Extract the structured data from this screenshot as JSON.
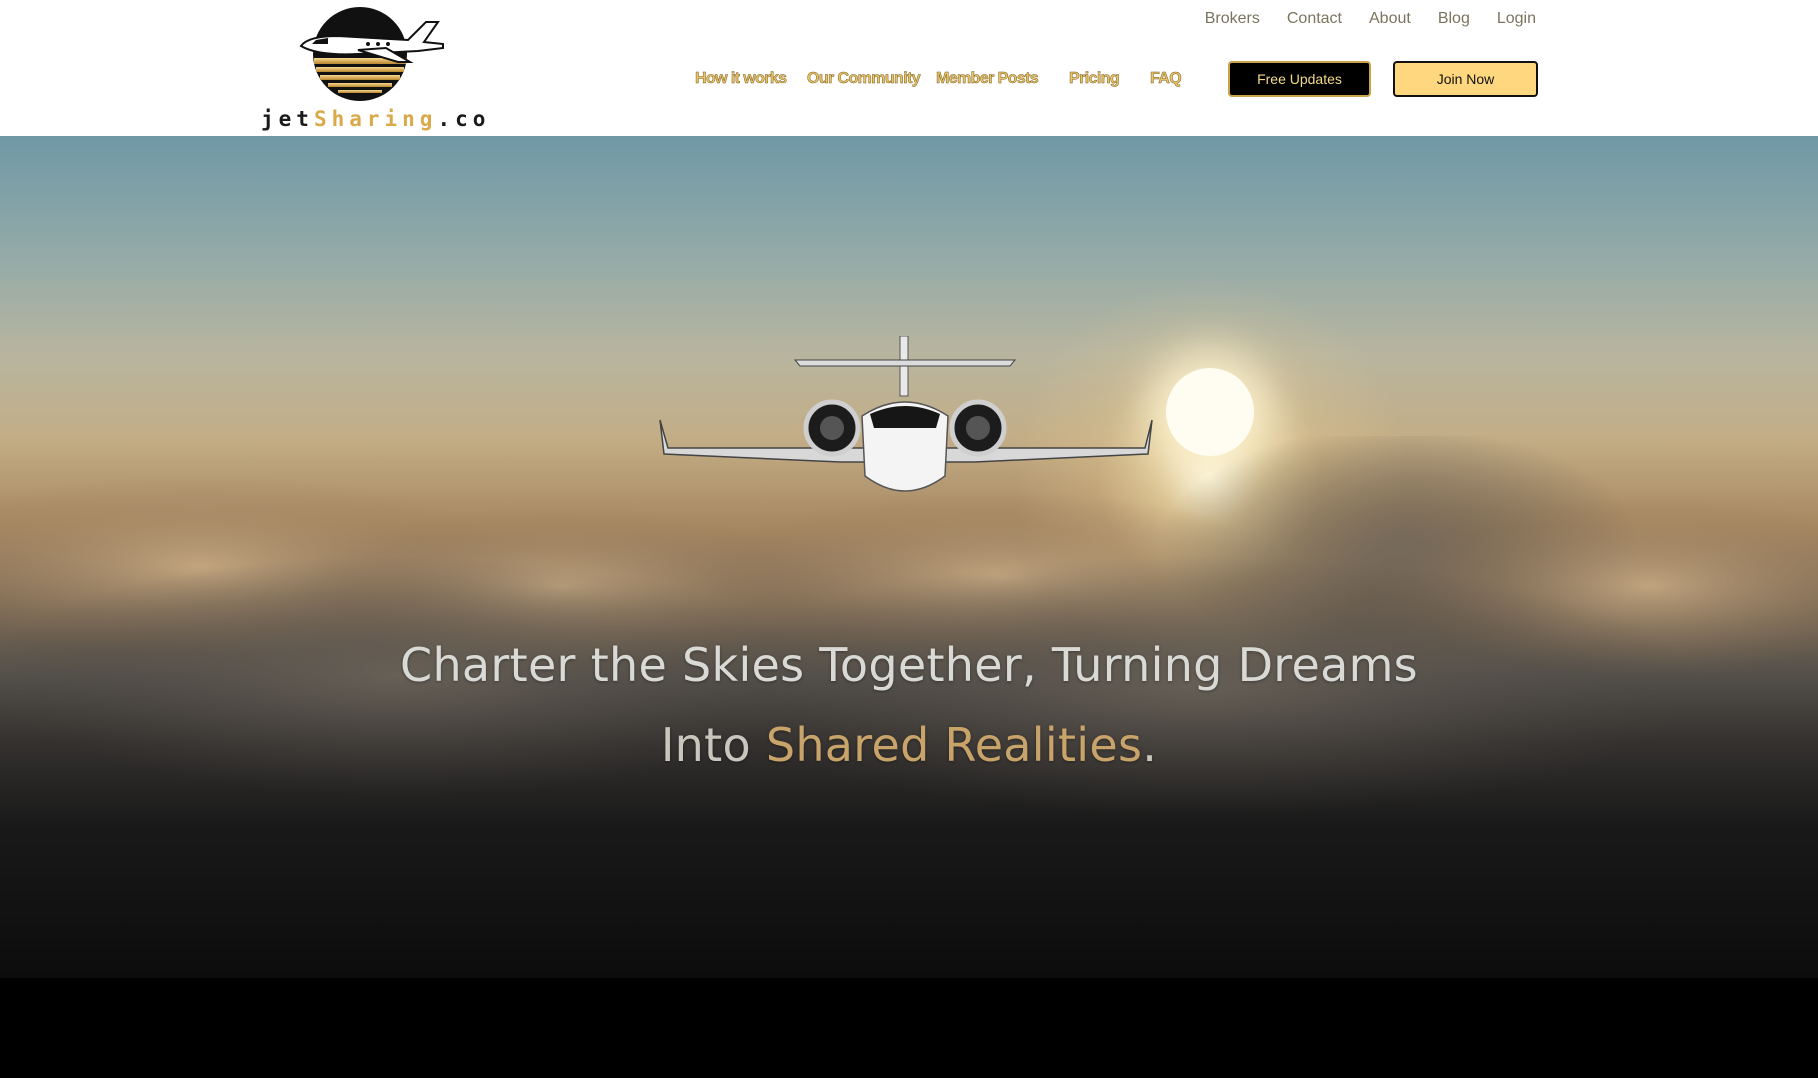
{
  "brand": {
    "logo_prefix": "jet",
    "logo_highlight": "Sharing",
    "logo_suffix": ".co"
  },
  "top_nav": {
    "brokers": "Brokers",
    "contact": "Contact",
    "about": "About",
    "blog": "Blog",
    "login": "Login"
  },
  "main_nav": {
    "how_it_works": "How it works",
    "our_community": "Our Community",
    "member_posts": "Member Posts",
    "pricing": "Pricing",
    "faq": "FAQ"
  },
  "buttons": {
    "free_updates": "Free Updates",
    "join_now": "Join Now"
  },
  "hero": {
    "line1": "Charter the Skies Together, Turning Dreams",
    "line2_prefix": "Into ",
    "line2_accent": "Shared Realities",
    "line2_suffix": "."
  },
  "icons": {
    "logo_emblem": "jet-emblem-icon"
  },
  "colors": {
    "gold_accent": "#e8c56a",
    "join_button_bg": "#ffd77f",
    "top_link": "#7a745f"
  }
}
